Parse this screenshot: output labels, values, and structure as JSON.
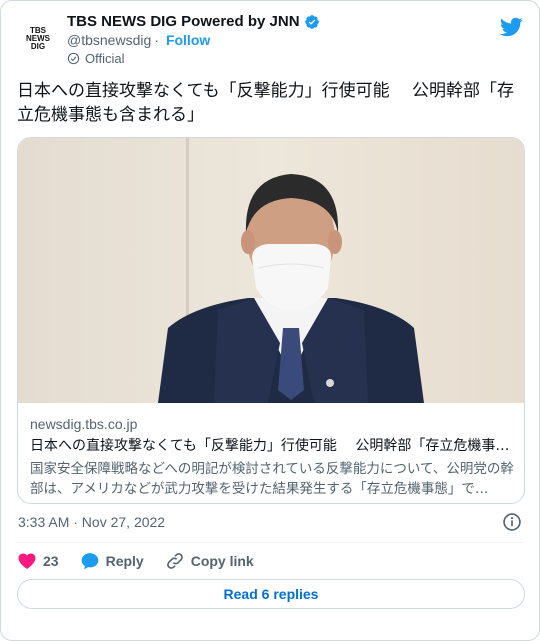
{
  "account": {
    "avatar_lines": [
      "TBS",
      "NEWS",
      "DIG"
    ],
    "display_name": "TBS NEWS DIG Powered by JNN",
    "handle": "@tbsnewsdig",
    "separator": "·",
    "follow_label": "Follow",
    "official_label": "Official",
    "verified_color": "#1d9bf0"
  },
  "tweet": {
    "text": "日本への直接攻撃なくても「反撃能力」行使可能　 公明幹部「存立危機事態も含まれる」",
    "timestamp": "3:33 AM · Nov 27, 2022"
  },
  "card": {
    "image_description_icon": "photo-of-speaker",
    "domain": "newsdig.tbs.co.jp",
    "title": "日本への直接攻撃なくても「反撃能力」行使可能　 公明幹部「存立危機事…",
    "description": "国家安全保障戦略などへの明記が検討されている反撃能力について、公明党の幹部は、アメリカなどが武力攻撃を受けた結果発生する「存立危機事態」で…"
  },
  "actions": {
    "like_count": "23",
    "reply_label": "Reply",
    "copy_link_label": "Copy link",
    "like_color": "#f91880",
    "reply_color": "#1d9bf0"
  },
  "footer": {
    "read_replies_label": "Read 6 replies"
  }
}
